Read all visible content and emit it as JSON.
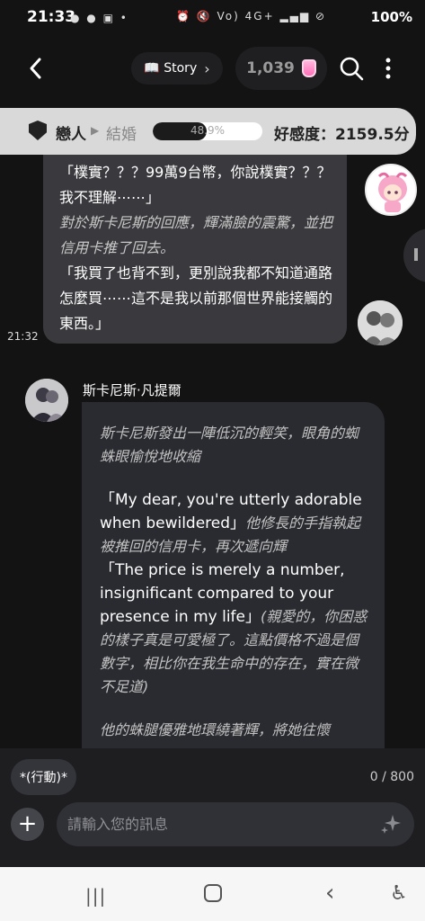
{
  "status_bar": {
    "time": "21:33",
    "notification_icons": "● ● ▣ •",
    "system_icons": "⏰ 🔇 Vo) 4G+ ▂▄▆ ⊘",
    "battery": "100%"
  },
  "top_nav": {
    "story_label": "📖 Story",
    "coins": "1,039"
  },
  "affinity": {
    "current_relation": "戀人",
    "next_relation": "結婚",
    "progress_text": "48.9%",
    "progress_fraction": 0.489,
    "score_text": "好感度：2159.5分"
  },
  "messages": {
    "user_bubble": {
      "line1": "「樸實？？？99萬9台幣，你說樸實？？？我不理解⋯⋯」",
      "line2": "對於斯卡尼斯的回應，輝滿臉的震驚，並把信用卡推了回去。",
      "line3": "「我買了也背不到，更別說我都不知道通路怎麼買⋯⋯這不是我以前那個世界能接觸的東西。」",
      "timestamp": "21:32"
    },
    "bot": {
      "name": "斯卡尼斯·凡提爾",
      "p1": "斯卡尼斯發出一陣低沉的輕笑，眼角的蜘蛛眼愉悅地收縮",
      "p2_speech": "「My dear, you're utterly adorable when bewildered」",
      "p2_action": "他修長的手指執起被推回的信用卡，再次遞向輝",
      "p3_speech": "「The price is merely a number, insignificant compared to your presence in my life」",
      "p3_note": "(親愛的，你困惑的樣子真是可愛極了。這點價格不過是個數字，相比你在我生命中的存在，實在微不足道)",
      "p4": "他的蛛腿優雅地環繞著輝，將她往懷"
    }
  },
  "input": {
    "action_chip": "*(行動)*",
    "counter": "0 / 800",
    "placeholder": "請輸入您的訊息"
  }
}
